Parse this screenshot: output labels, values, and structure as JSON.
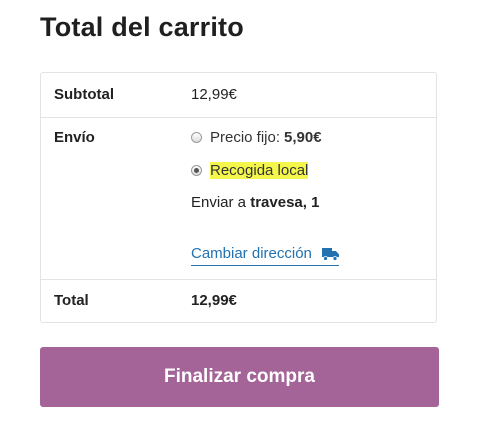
{
  "cart_totals": {
    "title": "Total del carrito",
    "subtotal_label": "Subtotal",
    "subtotal_value": "12,99€",
    "shipping_label": "Envío",
    "shipping_options": [
      {
        "label": "Precio fijo:",
        "price": "5,90€",
        "selected": false
      },
      {
        "label": "Recogida local",
        "selected": true
      }
    ],
    "ship_to_prefix": "Enviar a",
    "ship_to_address": "travesa, 1",
    "change_address_label": "Cambiar dirección",
    "total_label": "Total",
    "total_value": "12,99€"
  },
  "checkout_button": {
    "label": "Finalizar compra"
  },
  "colors": {
    "accent": "#a46497",
    "link": "#2271b1",
    "highlight": "#f4f64b"
  },
  "icons": {
    "change_address": "truck-icon"
  }
}
